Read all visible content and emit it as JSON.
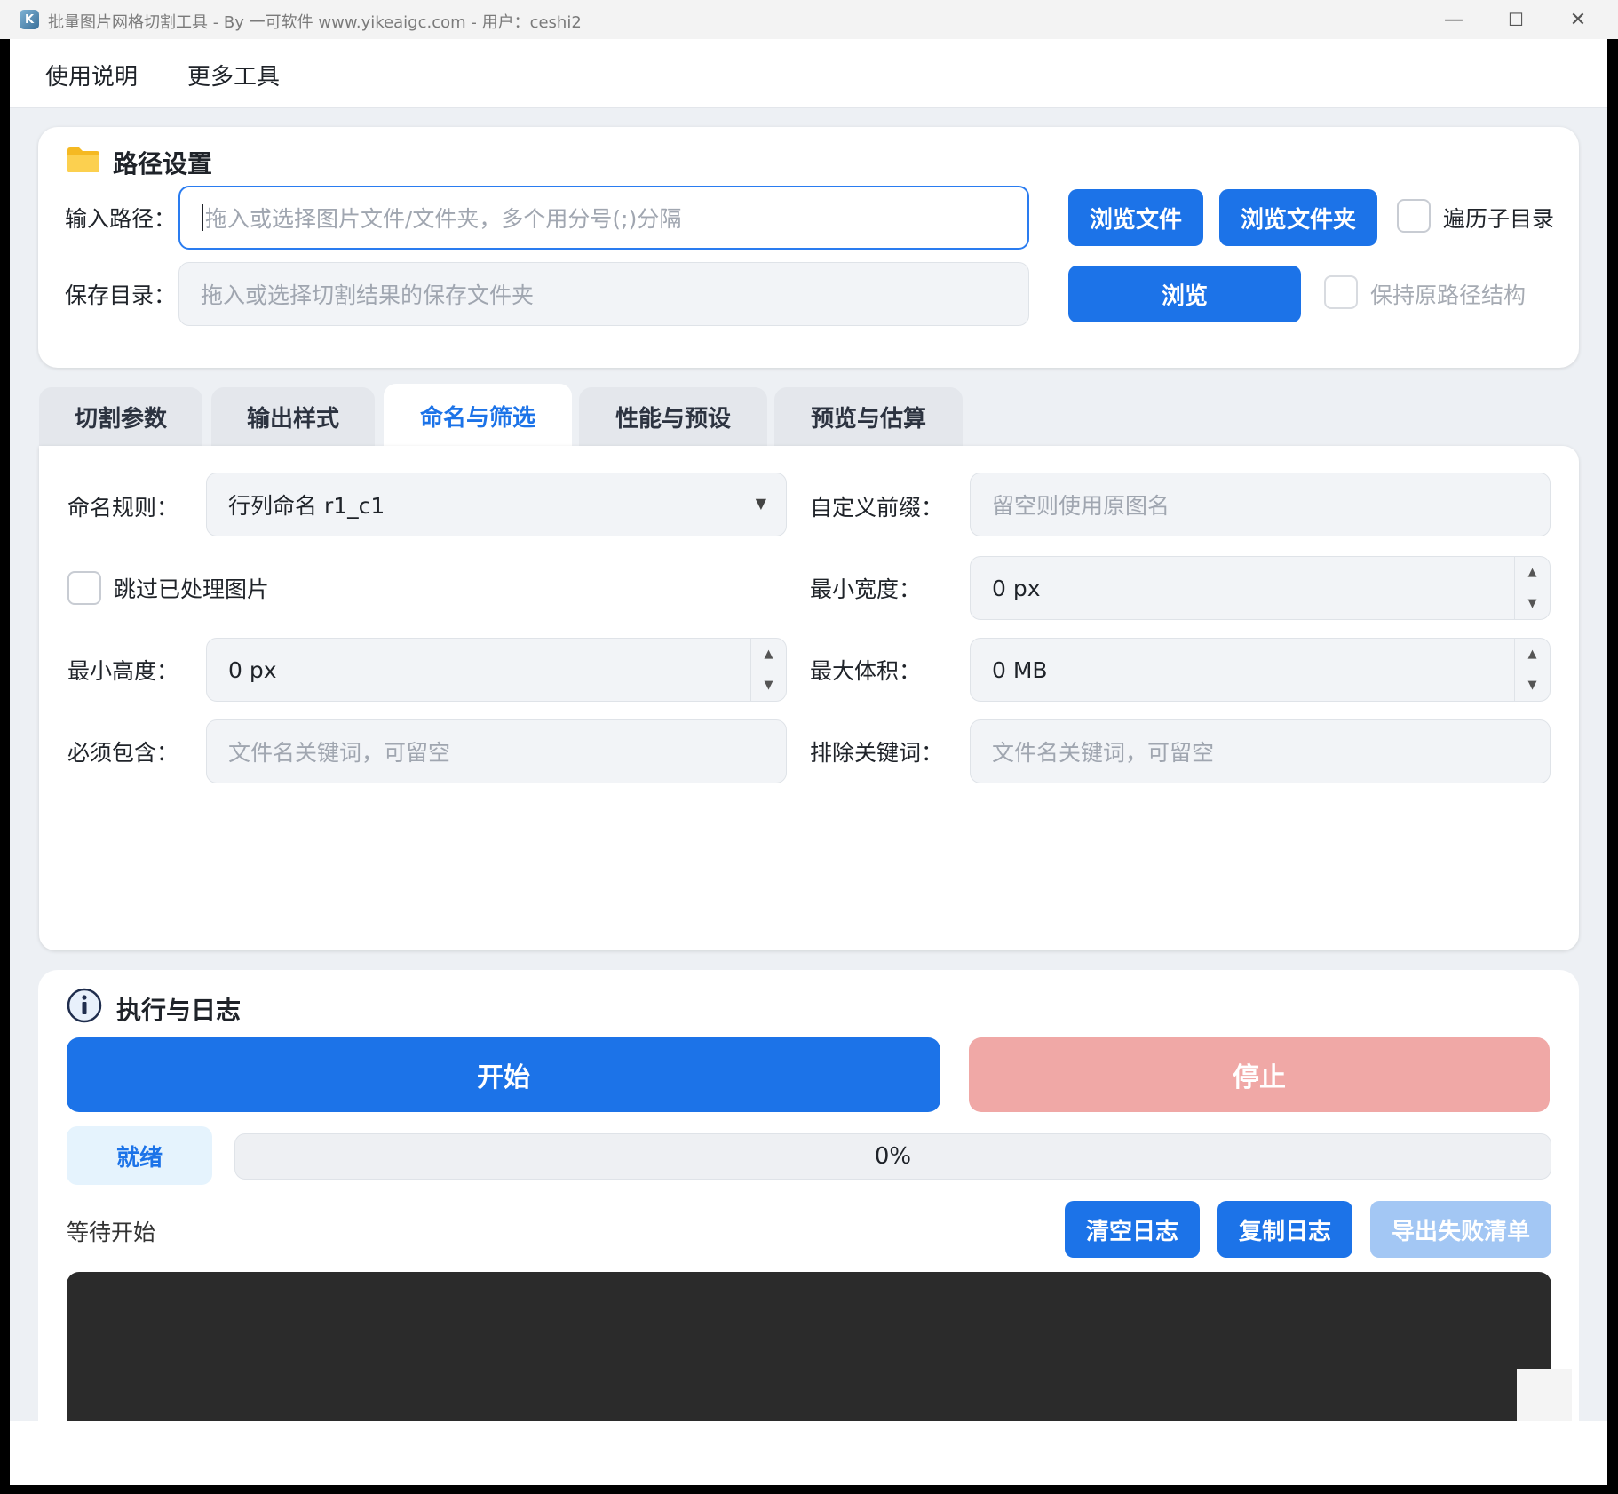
{
  "window": {
    "title": "批量图片网格切割工具 - By 一可软件 www.yikeaigc.com  -  用户：ceshi2",
    "icon_name": "app-icon",
    "controls": {
      "minimize": "—",
      "maximize": "☐",
      "close": "✕"
    }
  },
  "menu": [
    "使用说明",
    "更多工具"
  ],
  "path_settings": {
    "title": "路径设置",
    "icon_name": "folder-icon",
    "input_label": "输入路径：",
    "input_placeholder": "拖入或选择图片文件/文件夹，多个用分号(;)分隔",
    "browse_file": "浏览文件",
    "browse_folder": "浏览文件夹",
    "recurse_label": "遍历子目录",
    "save_label": "保存目录：",
    "save_placeholder": "拖入或选择切割结果的保存文件夹",
    "browse": "浏览",
    "keep_structure_label": "保持原路径结构"
  },
  "tabs": [
    {
      "label": "切割参数",
      "active": false
    },
    {
      "label": "输出样式",
      "active": false
    },
    {
      "label": "命名与筛选",
      "active": true
    },
    {
      "label": "性能与预设",
      "active": false
    },
    {
      "label": "预览与估算",
      "active": false
    }
  ],
  "naming": {
    "rule_label": "命名规则：",
    "rule_value": "行列命名 r1_c1",
    "prefix_label": "自定义前缀：",
    "prefix_placeholder": "留空则使用原图名",
    "skip_label": "跳过已处理图片",
    "min_width_label": "最小宽度：",
    "min_width_value": "0 px",
    "min_height_label": "最小高度：",
    "min_height_value": "0 px",
    "max_size_label": "最大体积：",
    "max_size_value": "0 MB",
    "include_label": "必须包含：",
    "include_placeholder": "文件名关键词，可留空",
    "exclude_label": "排除关键词：",
    "exclude_placeholder": "文件名关键词，可留空"
  },
  "execution": {
    "title": "执行与日志",
    "icon_name": "info-icon",
    "start": "开始",
    "stop": "停止",
    "status": "就绪",
    "progress_text": "0%",
    "progress_value": 0,
    "log_status": "等待开始",
    "clear_log": "清空日志",
    "copy_log": "复制日志",
    "export_failed": "导出失败清单"
  },
  "colors": {
    "accent": "#1c73e8",
    "stop": "#f0a8a6",
    "disabled": "#a3c7f4",
    "log_bg": "#2b2b2b"
  }
}
